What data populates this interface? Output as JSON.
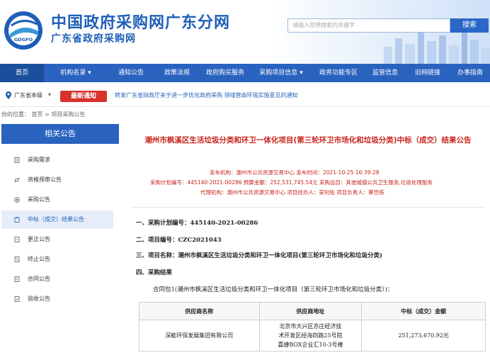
{
  "header": {
    "logo_text": "GDGPO",
    "title": "中国政府采购网广东分网",
    "subtitle": "广东省政府采购网",
    "search_placeholder": "请输入您想搜索的关键字",
    "search_button": "搜索",
    "brand_color": "#2a63bf"
  },
  "nav": {
    "items": [
      {
        "label": "首页"
      },
      {
        "label": "机构名录 ▾"
      },
      {
        "label": "通知公告"
      },
      {
        "label": "政策法规"
      },
      {
        "label": "政府购买服务"
      },
      {
        "label": "采购项目信息 ▾"
      },
      {
        "label": "政务功能专区"
      },
      {
        "label": "监管信息"
      },
      {
        "label": "旧网链接"
      },
      {
        "label": "办事指南"
      }
    ]
  },
  "notice": {
    "location": "广东省本级",
    "arrow": "▾",
    "badge": "最新通知",
    "text": "转发广东省财政厅关于进一步优化政府采购 领域营商环境实施意见的通知"
  },
  "breadcrumb": "你的位置：  首页 > 项目采购公告",
  "sidebar": {
    "title": "相关公告",
    "items": [
      {
        "label": "采购需求"
      },
      {
        "label": "资格预审公告"
      },
      {
        "label": "采购公告"
      },
      {
        "label": "中标（成交）结果公告"
      },
      {
        "label": "更正公告"
      },
      {
        "label": "终止公告"
      },
      {
        "label": "合同公告"
      },
      {
        "label": "验收公告"
      }
    ]
  },
  "article": {
    "title": "潮州市枫溪区生活垃圾分类和环卫一体化项目(第三轮环卫市场化和垃圾分类)中标（成交）结果公告",
    "meta_line1": "发布机构：潮州市公共资源交易中心      发布时间：2021-10-25 16:39:28",
    "meta_line2": "采购计划编号：445140-2021-00286      预算金额：252,531,745.54元      采购品目：其他城镇公共卫生服务,垃圾处理服务",
    "meta_line3": "代理机构：潮州市公共资源交易中心      项目经办人：吴钊佑      项目负责人：蔡世栋",
    "sec1_label": "一、采购计划编号：",
    "sec1_value": "445140-2021-00286",
    "sec2_label": "二、项目编号：",
    "sec2_value": "CZC2021043",
    "sec3_label": "三、项目名称：",
    "sec3_value": "潮州市枫溪区生活垃圾分类和环卫一体化项目(第三轮环卫市场化和垃圾分类)",
    "sec4_label": "四、采购结果",
    "package_line": "合同包1(潮州市枫溪区生活垃圾分类和环卫一体化项目（第三轮环卫市场化和垃圾分类）)：",
    "table_headers": [
      "供应商名称",
      "供应商地址",
      "中标（成交）金额"
    ],
    "table_row": {
      "supplier": "深能环保发展集团有限公司",
      "address_l1": "北京市大兴区亦庄经济技",
      "address_l2": "术开发区经海四路25号院",
      "address_l3": "嘉捷BOX企业汇10-3号楼",
      "amount": "251,273,670.92元"
    }
  }
}
